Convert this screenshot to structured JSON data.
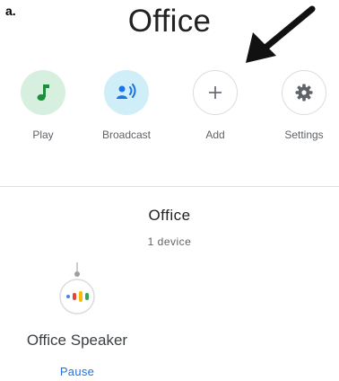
{
  "figure_label": "a.",
  "header": {
    "room_title": "Office"
  },
  "actions": [
    {
      "label": "Play",
      "icon": "music-note-icon",
      "color": "#1e8e3e"
    },
    {
      "label": "Broadcast",
      "icon": "broadcast-icon",
      "color": "#1a73e8"
    },
    {
      "label": "Add",
      "icon": "plus-icon",
      "color": "#5f6368"
    },
    {
      "label": "Settings",
      "icon": "gear-icon",
      "color": "#5f6368"
    }
  ],
  "room_card": {
    "title": "Office",
    "device_count": "1 device",
    "device": {
      "name": "Office Speaker",
      "icon": "google-home-speaker-icon",
      "action_label": "Pause"
    }
  },
  "colors": {
    "accent": "#1a73e8",
    "play_bg": "#d7efdf",
    "broadcast_bg": "#cfeef7",
    "dots": [
      "#4285f4",
      "#ea4335",
      "#fbbc04",
      "#34a853"
    ]
  }
}
